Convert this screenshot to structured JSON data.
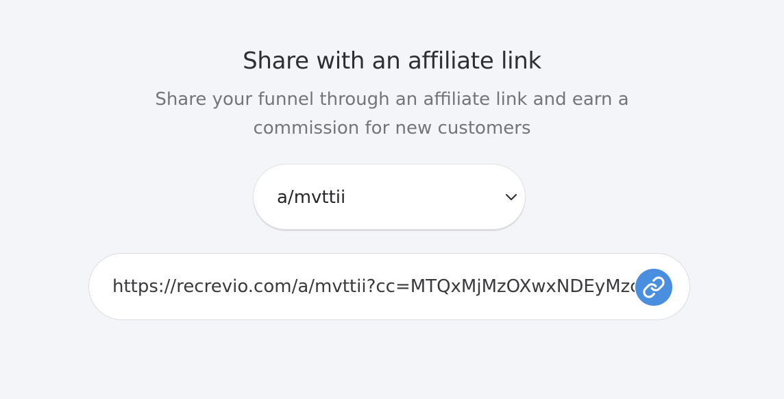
{
  "share": {
    "title": "Share with an affiliate link",
    "subtitle": "Share your funnel through an affiliate link and earn a commission for new customers"
  },
  "affiliate_select": {
    "selected": "a/mvttii",
    "icon": "chevron-down-icon"
  },
  "link_field": {
    "value": "https://recrevio.com/a/mvttii?cc=MTQxMjMzOXwxNDEyMzc",
    "copy_icon": "link-icon",
    "accent_color": "#4a8ee0"
  }
}
